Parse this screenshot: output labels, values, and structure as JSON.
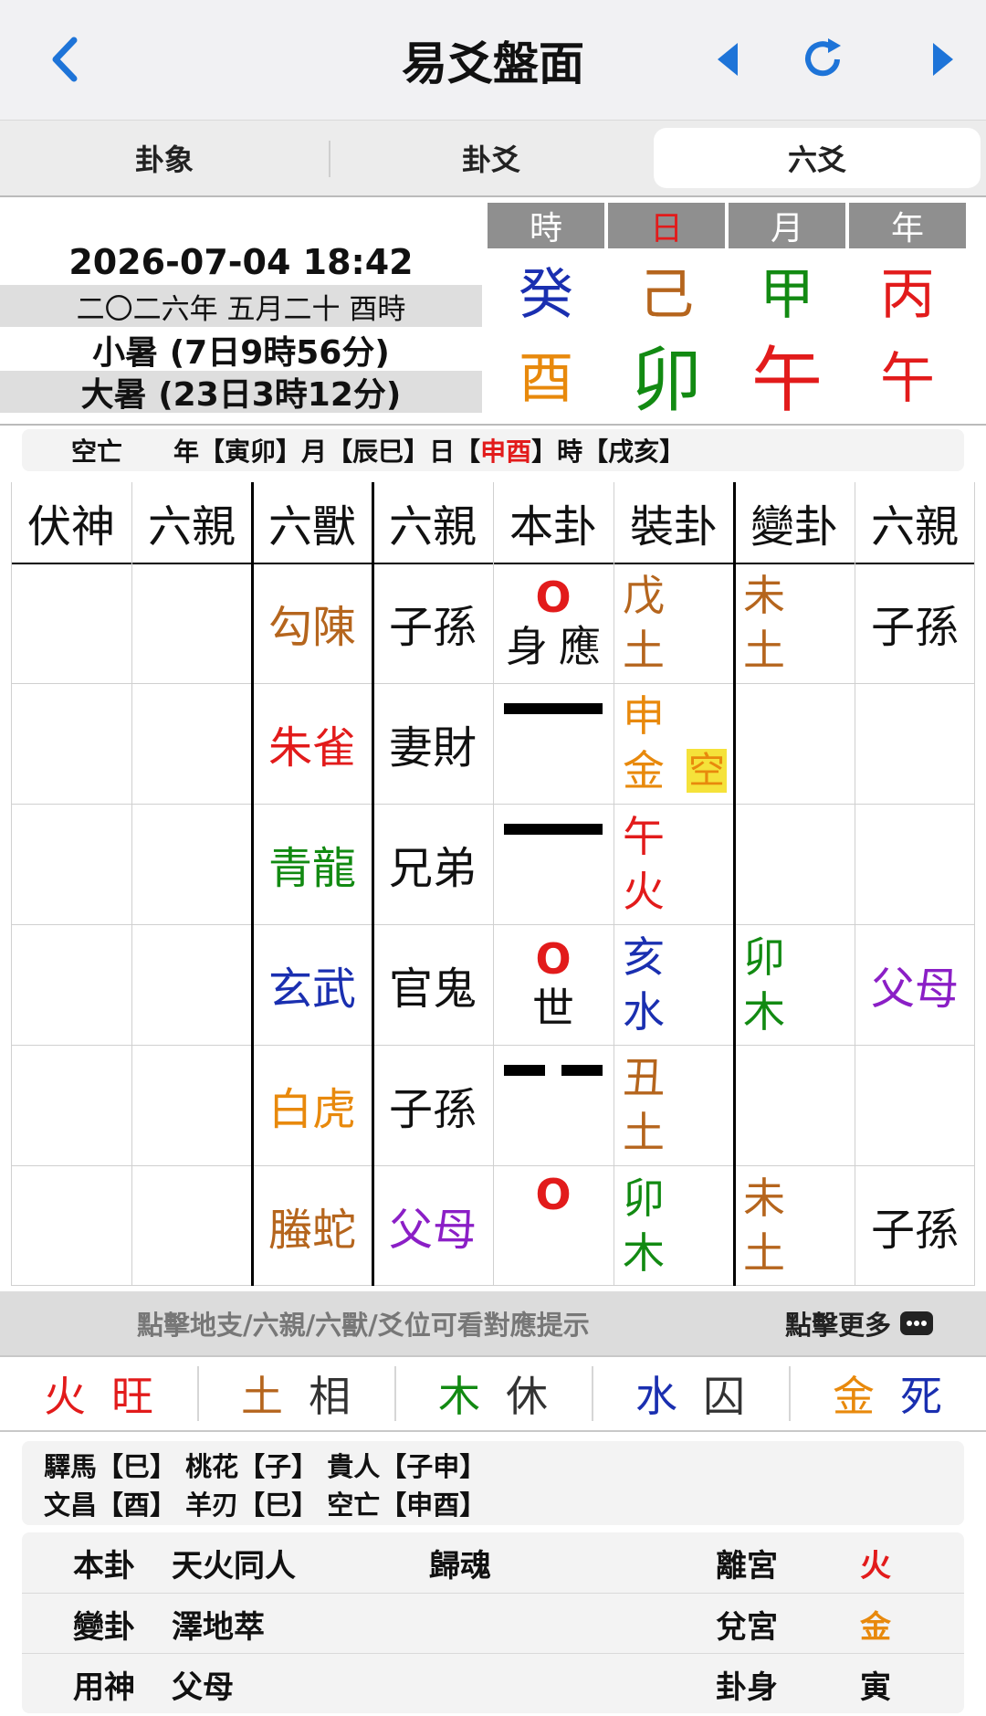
{
  "header": {
    "title": "易爻盤面"
  },
  "tabs": [
    "卦象",
    "卦爻",
    "六爻"
  ],
  "info": {
    "datetime": "2026-07-04 18:42",
    "lunar": "二〇二六年 五月二十 酉時",
    "term1": "小暑 (7日9時56分)",
    "term2": "大暑 (23日3時12分)"
  },
  "pillars": {
    "heads": [
      "時",
      "日",
      "月",
      "年"
    ],
    "stems": [
      "癸",
      "己",
      "甲",
      "丙"
    ],
    "branches": [
      "酉",
      "卯",
      "午",
      "午"
    ]
  },
  "kongwang": {
    "label": "空亡",
    "year_label": "年",
    "year": "【寅卯】",
    "month_label": "月",
    "month": "【辰巳】",
    "day_label": "日",
    "day_open": "【",
    "day": "申酉",
    "day_close": "】",
    "hour_label": "時",
    "hour": "【戌亥】"
  },
  "table": {
    "headers": [
      "伏神",
      "六親",
      "六獸",
      "六親",
      "本卦",
      "裝卦",
      "變卦",
      "六親"
    ],
    "rows": [
      {
        "beast": "勾陳",
        "kin": "子孫",
        "yao": "moving-yang",
        "move": "O",
        "marks": [
          "身",
          "應"
        ],
        "branch": [
          "戊",
          "土"
        ],
        "changed": [
          "未",
          "土"
        ],
        "changed_kin": "子孫",
        "empty": ""
      },
      {
        "beast": "朱雀",
        "kin": "妻財",
        "yao": "yang",
        "move": "",
        "marks": [],
        "branch": [
          "申",
          "金"
        ],
        "changed": [],
        "changed_kin": "",
        "empty": "空"
      },
      {
        "beast": "青龍",
        "kin": "兄弟",
        "yao": "yang",
        "move": "",
        "marks": [],
        "branch": [
          "午",
          "火"
        ],
        "changed": [],
        "changed_kin": "",
        "empty": ""
      },
      {
        "beast": "玄武",
        "kin": "官鬼",
        "yao": "moving-yang",
        "move": "O",
        "marks": [
          "世"
        ],
        "branch": [
          "亥",
          "水"
        ],
        "changed": [
          "卯",
          "木"
        ],
        "changed_kin": "父母",
        "empty": ""
      },
      {
        "beast": "白虎",
        "kin": "子孫",
        "yao": "yin",
        "move": "",
        "marks": [],
        "branch": [
          "丑",
          "土"
        ],
        "changed": [],
        "changed_kin": "",
        "empty": ""
      },
      {
        "beast": "螣蛇",
        "kin": "父母",
        "yao": "moving-yang",
        "move": "O",
        "marks": [],
        "branch": [
          "卯",
          "木"
        ],
        "changed": [
          "未",
          "土"
        ],
        "changed_kin": "子孫",
        "empty": ""
      }
    ]
  },
  "hint": {
    "text": "點擊地支/六親/六獸/爻位可看對應提示",
    "more": "點擊更多"
  },
  "wuxing": [
    {
      "el": "火",
      "state": "旺"
    },
    {
      "el": "土",
      "state": "相"
    },
    {
      "el": "木",
      "state": "休"
    },
    {
      "el": "水",
      "state": "囚"
    },
    {
      "el": "金",
      "state": "死"
    }
  ],
  "shensha": {
    "line1": "驛馬【巳】 桃花【子】 貴人【子申】",
    "line2": "文昌【酉】 羊刃【巳】 空亡【申酉】"
  },
  "gua": {
    "rows": [
      {
        "label": "本卦",
        "name": "天火同人",
        "type": "歸魂",
        "palace": "離宮",
        "element": "火"
      },
      {
        "label": "變卦",
        "name": "澤地萃",
        "type": "",
        "palace": "兌宮",
        "element": "金"
      },
      {
        "label": "用神",
        "name": "父母",
        "type": "",
        "palace": "卦身",
        "element": "寅"
      }
    ]
  },
  "colors": {
    "accent_blue": "#1e74d8",
    "fire": "#e21b1b",
    "earth": "#b5651d",
    "wood": "#128a12",
    "water": "#1a2fb0",
    "metal": "#e8890c",
    "purple": "#8b1fc6",
    "empty_highlight": "#f5e23a"
  },
  "icons": [
    "back-chevron-icon",
    "prev-triangle-icon",
    "refresh-icon",
    "next-triangle-icon",
    "more-dots-icon"
  ]
}
